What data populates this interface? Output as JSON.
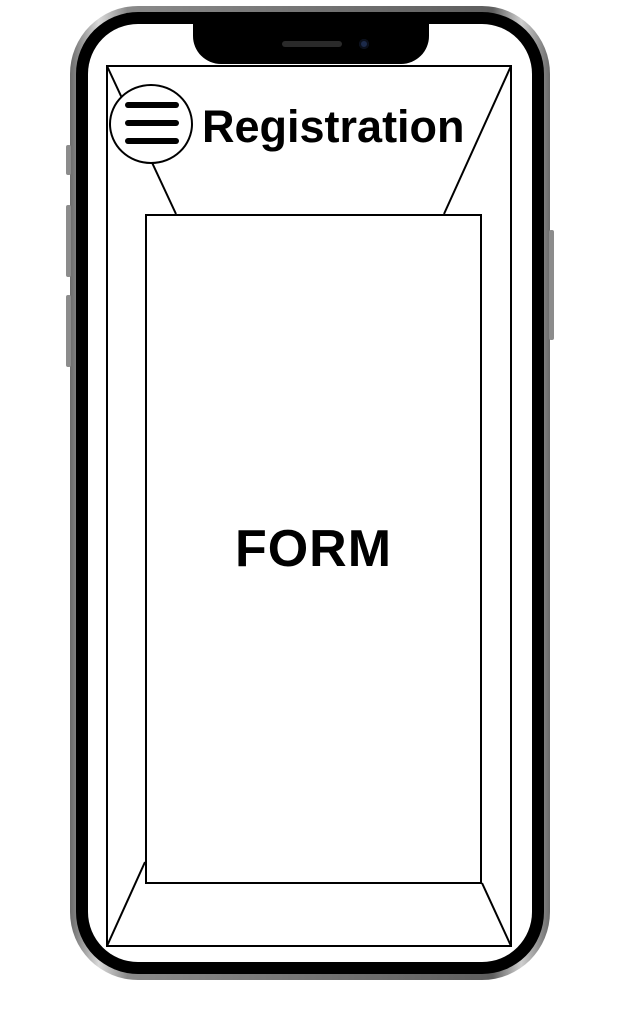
{
  "header": {
    "title": "Registration",
    "menu_icon": "hamburger-menu-icon"
  },
  "main": {
    "form_label": "FORM"
  },
  "colors": {
    "stroke": "#000000",
    "screen_background": "#ffffff",
    "device_bezel": "#000000"
  }
}
